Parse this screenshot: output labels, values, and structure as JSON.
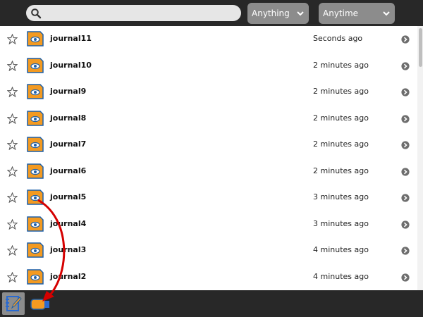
{
  "toolbar": {
    "search": {
      "value": "",
      "placeholder": "",
      "icon": "search-icon"
    },
    "what_filter": {
      "selected": "Anything"
    },
    "when_filter": {
      "selected": "Anytime"
    }
  },
  "entries": [
    {
      "title": "journal11",
      "time": "Seconds ago"
    },
    {
      "title": "journal10",
      "time": "2 minutes ago"
    },
    {
      "title": "journal9",
      "time": "2 minutes ago"
    },
    {
      "title": "journal8",
      "time": "2 minutes ago"
    },
    {
      "title": "journal7",
      "time": "2 minutes ago"
    },
    {
      "title": "journal6",
      "time": "2 minutes ago"
    },
    {
      "title": "journal5",
      "time": "3 minutes ago"
    },
    {
      "title": "journal4",
      "time": "3 minutes ago"
    },
    {
      "title": "journal3",
      "time": "4 minutes ago"
    },
    {
      "title": "journal2",
      "time": "4 minutes ago"
    }
  ],
  "bottom_bar": {
    "items": [
      {
        "icon": "journal-icon",
        "selected": true
      },
      {
        "icon": "usb-drive-icon",
        "selected": false
      }
    ]
  },
  "colors": {
    "toolbar_bg": "#282828",
    "control_bg": "#8c8c8c",
    "file_icon_fill": "#f39a21",
    "file_icon_stroke": "#1c5fa8",
    "annotation_arrow": "#d50000"
  }
}
